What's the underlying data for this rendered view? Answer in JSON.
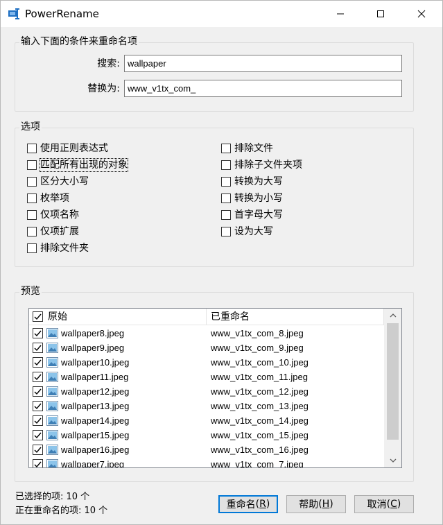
{
  "window": {
    "title": "PowerRename"
  },
  "criteria": {
    "legend": "输入下面的条件来重命名项",
    "search_label": "搜索:",
    "search_value": "wallpaper",
    "replace_label": "替换为:",
    "replace_value": "www_v1tx_com_"
  },
  "options": {
    "legend": "选项",
    "left": [
      {
        "label": "使用正则表达式",
        "checked": false
      },
      {
        "label": "匹配所有出现的对象",
        "checked": false
      },
      {
        "label": "区分大小写",
        "checked": false
      },
      {
        "label": "枚举项",
        "checked": false
      },
      {
        "label": "仅项名称",
        "checked": false
      },
      {
        "label": "仅项扩展",
        "checked": false
      },
      {
        "label": "排除文件夹",
        "checked": false
      }
    ],
    "right": [
      {
        "label": "排除文件",
        "checked": false
      },
      {
        "label": "排除子文件夹项",
        "checked": false
      },
      {
        "label": "转换为大写",
        "checked": false
      },
      {
        "label": "转换为小写",
        "checked": false
      },
      {
        "label": "首字母大写",
        "checked": false
      },
      {
        "label": "设为大写",
        "checked": false
      }
    ]
  },
  "preview": {
    "legend": "预览",
    "col_original": "原始",
    "col_renamed": "已重命名",
    "rows": [
      {
        "original": "wallpaper8.jpeg",
        "renamed": "www_v1tx_com_8.jpeg",
        "checked": true
      },
      {
        "original": "wallpaper9.jpeg",
        "renamed": "www_v1tx_com_9.jpeg",
        "checked": true
      },
      {
        "original": "wallpaper10.jpeg",
        "renamed": "www_v1tx_com_10.jpeg",
        "checked": true
      },
      {
        "original": "wallpaper11.jpeg",
        "renamed": "www_v1tx_com_11.jpeg",
        "checked": true
      },
      {
        "original": "wallpaper12.jpeg",
        "renamed": "www_v1tx_com_12.jpeg",
        "checked": true
      },
      {
        "original": "wallpaper13.jpeg",
        "renamed": "www_v1tx_com_13.jpeg",
        "checked": true
      },
      {
        "original": "wallpaper14.jpeg",
        "renamed": "www_v1tx_com_14.jpeg",
        "checked": true
      },
      {
        "original": "wallpaper15.jpeg",
        "renamed": "www_v1tx_com_15.jpeg",
        "checked": true
      },
      {
        "original": "wallpaper16.jpeg",
        "renamed": "www_v1tx_com_16.jpeg",
        "checked": true
      },
      {
        "original": "wallpaper7.jpeg",
        "renamed": "www_v1tx_com_7.jpeg",
        "checked": true
      }
    ]
  },
  "status": {
    "selected": "已选择的项: 10 个",
    "renaming": "正在重命名的项: 10 个"
  },
  "buttons": {
    "rename": "重命名",
    "rename_accel": "R",
    "help": "帮助",
    "help_accel": "H",
    "cancel": "取消",
    "cancel_accel": "C"
  },
  "colors": {
    "accent": "#0078d7",
    "window_bg": "#f0f0f0"
  }
}
